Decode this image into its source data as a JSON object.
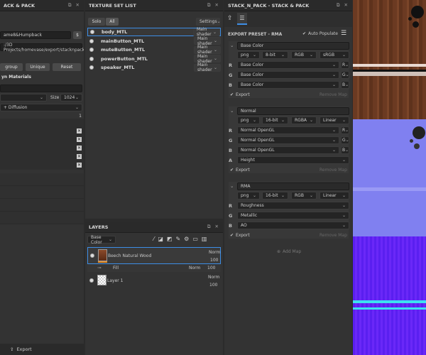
{
  "left_panel": {
    "title": "ACK & PACK",
    "name_value": "ame8&Humpback",
    "name_btn": "$",
    "path": ":/3D Projects/homevase/export/stacknpack",
    "buttons": [
      "group",
      "Unique",
      "Reset"
    ],
    "section": "yn Materials",
    "size_label": "Size",
    "size_value": "1024",
    "mode_value": "+ Diffusion",
    "one": "1",
    "export": "Export"
  },
  "texture_set": {
    "title": "TEXTURE SET LIST",
    "tabs": [
      "Solo",
      "All"
    ],
    "settings": "Settings",
    "items": [
      {
        "name": "body_MTL",
        "shader": "Main shader"
      },
      {
        "name": "mainButton_MTL",
        "shader": "Main shader"
      },
      {
        "name": "muteButton_MTL",
        "shader": "Main shader"
      },
      {
        "name": "powerButton_MTL",
        "shader": "Main shader"
      },
      {
        "name": "speaker_MTL",
        "shader": "Main shader"
      }
    ]
  },
  "layers": {
    "title": "LAYERS",
    "channel": "Base Color",
    "items": [
      {
        "name": "Beech Natural Wood",
        "blend": "Norm",
        "opacity": "100"
      },
      {
        "name": "Fill",
        "blend": "Norm",
        "opacity": "100",
        "sub": true
      },
      {
        "name": "Layer 1",
        "blend": "Norm",
        "opacity": "100"
      }
    ]
  },
  "stack": {
    "title": "STACK_N_PACK - STACK & PACK",
    "preset_label": "EXPORT PRESET - ",
    "preset_name": "RMA",
    "auto_populate": "Auto Populate",
    "add_map": "Add Map",
    "remove_map": "Remove Map",
    "export": "Export",
    "maps": [
      {
        "name": "Base Color",
        "format": "png",
        "bits": "8-bit",
        "mode": "RGB",
        "space": "sRGB",
        "channels": [
          {
            "ch": "R",
            "src": "Base Color",
            "c": "R"
          },
          {
            "ch": "G",
            "src": "Base Color",
            "c": "G"
          },
          {
            "ch": "B",
            "src": "Base Color",
            "c": "B"
          }
        ]
      },
      {
        "name": "Normal",
        "format": "png",
        "bits": "16-bit",
        "mode": "RGBA",
        "space": "Linear",
        "channels": [
          {
            "ch": "R",
            "src": "Normal OpenGL",
            "c": "R"
          },
          {
            "ch": "G",
            "src": "Normal OpenGL",
            "c": "G"
          },
          {
            "ch": "B",
            "src": "Normal OpenGL",
            "c": "B"
          },
          {
            "ch": "A",
            "src": "Height",
            "c": ""
          }
        ]
      },
      {
        "name": "RMA",
        "format": "png",
        "bits": "16-bit",
        "mode": "RGB",
        "space": "Linear",
        "channels": [
          {
            "ch": "R",
            "src": "Roughness",
            "c": ""
          },
          {
            "ch": "G",
            "src": "Metallic",
            "c": ""
          },
          {
            "ch": "B",
            "src": "AO",
            "c": ""
          }
        ]
      }
    ]
  },
  "colors": {
    "accent": "#3d8ee6",
    "wood": "#6b3a22",
    "normal": "#7f7ff0",
    "rma": "#5a1ff0"
  }
}
